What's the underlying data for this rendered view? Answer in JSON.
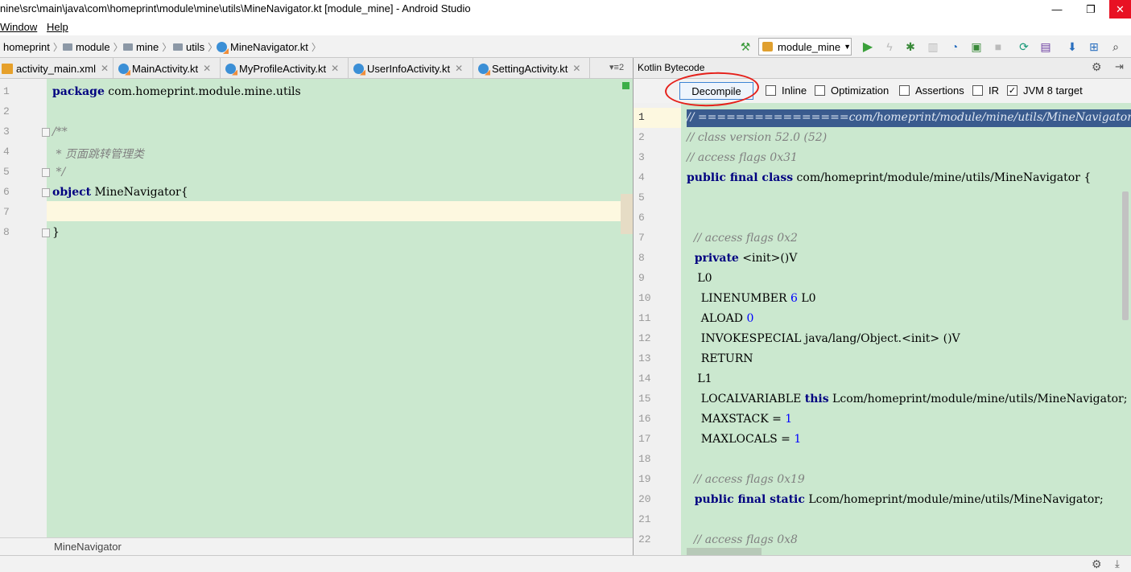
{
  "window": {
    "title": "nine\\src\\main\\java\\com\\homeprint\\module\\mine\\utils\\MineNavigator.kt [module_mine] - Android Studio",
    "minimize": "—",
    "restore": "❐",
    "close": "✕"
  },
  "menu": {
    "window": "Window",
    "help": "Help"
  },
  "breadcrumbs": [
    "homeprint",
    "module",
    "mine",
    "utils",
    "MineNavigator.kt"
  ],
  "run_config": {
    "label": "module_mine"
  },
  "toolbar_icons": [
    "hammer-icon",
    "run-icon",
    "apply-changes-icon",
    "debug-icon",
    "profile-icon",
    "attach-icon",
    "coverage-icon",
    "stop-icon",
    "sync-icon",
    "avd-icon",
    "sdk-icon",
    "search-icon"
  ],
  "tabs": [
    {
      "label": "activity_main.xml",
      "icon": "xml"
    },
    {
      "label": "MainActivity.kt",
      "icon": "kotlin"
    },
    {
      "label": "MyProfileActivity.kt",
      "icon": "kotlin"
    },
    {
      "label": "UserInfoActivity.kt",
      "icon": "kotlin"
    },
    {
      "label": "SettingActivity.kt",
      "icon": "kotlin"
    }
  ],
  "tabs_more": "▾≡2",
  "editor": {
    "line_numbers": [
      "1",
      "2",
      "3",
      "4",
      "5",
      "6",
      "7",
      "8"
    ],
    "lines": {
      "l1_kw": "package",
      "l1_rest": " com.homeprint.module.mine.utils",
      "l3": "/**",
      "l4": " * 页面跳转管理类",
      "l5": " */",
      "l6_kw": "object",
      "l6_rest": " MineNavigator{",
      "l8": "}"
    },
    "status": "MineNavigator"
  },
  "bytecode_panel": {
    "title": "Kotlin Bytecode",
    "decompile": "Decompile",
    "options": [
      {
        "label": "Inline",
        "checked": false
      },
      {
        "label": "Optimization",
        "checked": false
      },
      {
        "label": "Assertions",
        "checked": false
      },
      {
        "label": "IR",
        "checked": false
      },
      {
        "label": "JVM 8 target",
        "checked": true
      }
    ],
    "line_numbers": [
      "1",
      "2",
      "3",
      "4",
      "5",
      "6",
      "7",
      "8",
      "9",
      "10",
      "11",
      "12",
      "13",
      "14",
      "15",
      "16",
      "17",
      "18",
      "19",
      "20",
      "21",
      "22"
    ],
    "lines": {
      "b1": "// ================com/homeprint/module/mine/utils/MineNavigator.class",
      "b2": "// class version 52.0 (52)",
      "b3": "// access flags 0x31",
      "b4_kw": "public final class",
      "b4_rest": " com/homeprint/module/mine/utils/MineNavigator {",
      "b7": "  // access flags 0x2",
      "b8_kw": "  private",
      "b8_rest": " <init>()V",
      "b9": "   L0",
      "b10_a": "    LINENUMBER ",
      "b10_n": "6",
      "b10_b": " L0",
      "b11_a": "    ALOAD ",
      "b11_n": "0",
      "b12": "    INVOKESPECIAL java/lang/Object.<init> ()V",
      "b13": "    RETURN",
      "b14": "   L1",
      "b15_a": "    LOCALVARIABLE ",
      "b15_kw": "this",
      "b15_b": " Lcom/homeprint/module/mine/utils/MineNavigator;",
      "b16_a": "    MAXSTACK = ",
      "b16_n": "1",
      "b17_a": "    MAXLOCALS = ",
      "b17_n": "1",
      "b19": "  // access flags 0x19",
      "b20_kw": "  public final static",
      "b20_rest": " Lcom/homeprint/module/mine/utils/MineNavigator;",
      "b22": "  // access flags 0x8"
    }
  },
  "colors": {
    "code_bg": "#cbe8cf",
    "keyword": "#000080",
    "comment": "#808080",
    "number": "#0000ff",
    "annotation": "#e5201a"
  }
}
